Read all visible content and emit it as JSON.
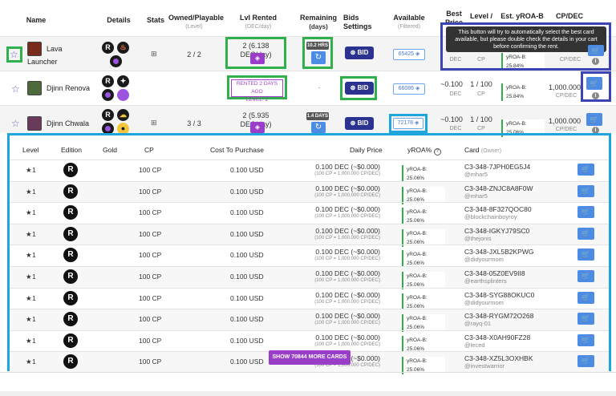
{
  "header": {
    "name": "Name",
    "details": "Details",
    "stats": "Stats",
    "owned": "Owned/Playable",
    "owned_sub": "(Level)",
    "lvl_rented": "Lvl Rented",
    "lvl_rented_sub": "(DEC/day)",
    "remaining": "Remaining",
    "remaining_sub": "(days)",
    "bids": "Bids",
    "bids2": "Settings",
    "available": "Available",
    "available_sub": "(Filtered)",
    "best_price": "Best",
    "best_price2": "Price",
    "level_cp": "Level /",
    "est_yroa": "Est. yROA-B",
    "cp_dec": "CP/DEC"
  },
  "tooltip": {
    "line1": "This button will try to automatically select the best card",
    "line2": "available, but please double check the details in your cart",
    "line3": "before confirming the rent."
  },
  "cards": [
    {
      "name": "Lava",
      "name2": "Launcher",
      "owned": "2 / 2",
      "rented": "2 (6.138 DEC/day)",
      "remaining_badge": "10.2 HRS",
      "bid": "BID",
      "available": "65425",
      "best_price_unit": "DEC",
      "level_unit": "CP",
      "yroa": "yROA-B: 25.84%",
      "cpdec_unit": "CP/DEC",
      "thumb_color": "#7a2a1a"
    },
    {
      "name": "Djinn Renova",
      "owned": "",
      "rented_line1": "RENTED 2 DAYS AGO",
      "rented_line2": "LEVEL: 2",
      "remaining": "-",
      "bid": "BID",
      "available": "66086",
      "best_price": "~0.100",
      "best_price_unit": "DEC",
      "level": "1 / 100",
      "level_unit": "CP",
      "yroa": "yROA-B: 25.84%",
      "cpdec": "1,000.000",
      "cpdec_unit": "CP/DEC",
      "thumb_color": "#4c6a3a"
    },
    {
      "name": "Djinn Chwala",
      "owned": "3 / 3",
      "rented": "2 (5.935 DEC/day)",
      "remaining_badge": "1.4 DAYS",
      "bid": "BID",
      "available": "72178",
      "best_price": "~0.100",
      "best_price_unit": "DEC",
      "level": "1 / 100",
      "level_unit": "CP",
      "yroa": "yROA-B: 25.06%",
      "cpdec": "1,000.000",
      "cpdec_unit": "CP/DEC",
      "thumb_color": "#6a3a5a"
    }
  ],
  "sub_table": {
    "headers": {
      "level": "Level",
      "edition": "Edition",
      "gold": "Gold",
      "cp": "CP",
      "cost": "Cost To Purchase",
      "daily": "Daily Price",
      "yroa": "yROA%",
      "card": "Card",
      "card_sub": "(Owner)"
    },
    "rows": [
      {
        "level": "1",
        "cp": "100 CP",
        "cost": "0.100 USD",
        "price": "0.100 DEC (~$0.000)",
        "price_sub": "(100 CP = 1,000.000 CP/DEC)",
        "yroa": "yROA-B: 25.06%",
        "card": "C3-348-7JPH0EG5J4",
        "owner": "@mhar5"
      },
      {
        "level": "1",
        "cp": "100 CP",
        "cost": "0.100 USD",
        "price": "0.100 DEC (~$0.000)",
        "price_sub": "(100 CP = 1,000.000 CP/DEC)",
        "yroa": "yROA-B: 25.06%",
        "card": "C3-348-ZNJC8A8F0W",
        "owner": "@mhar5"
      },
      {
        "level": "1",
        "cp": "100 CP",
        "cost": "0.100 USD",
        "price": "0.100 DEC (~$0.000)",
        "price_sub": "(100 CP = 1,000.000 CP/DEC)",
        "yroa": "yROA-B: 25.06%",
        "card": "C3-348-8F327QOC80",
        "owner": "@blockchainboyroy"
      },
      {
        "level": "1",
        "cp": "100 CP",
        "cost": "0.100 USD",
        "price": "0.100 DEC (~$0.000)",
        "price_sub": "(100 CP = 1,000.000 CP/DEC)",
        "yroa": "yROA-B: 25.06%",
        "card": "C3-348-IGKYJ79SC0",
        "owner": "@thejonis"
      },
      {
        "level": "1",
        "cp": "100 CP",
        "cost": "0.100 USD",
        "price": "0.100 DEC (~$0.000)",
        "price_sub": "(100 CP = 1,000.000 CP/DEC)",
        "yroa": "yROA-B: 25.06%",
        "card": "C3-348-JXL5B2KPWG",
        "owner": "@didyourmom"
      },
      {
        "level": "1",
        "cp": "100 CP",
        "cost": "0.100 USD",
        "price": "0.100 DEC (~$0.000)",
        "price_sub": "(100 CP = 1,000.000 CP/DEC)",
        "yroa": "yROA-B: 25.06%",
        "card": "C3-348-05Z0EV9II8",
        "owner": "@earthsplinters"
      },
      {
        "level": "1",
        "cp": "100 CP",
        "cost": "0.100 USD",
        "price": "0.100 DEC (~$0.000)",
        "price_sub": "(100 CP = 1,000.000 CP/DEC)",
        "yroa": "yROA-B: 25.06%",
        "card": "C3-348-SYG88OKUC0",
        "owner": "@didyourmom"
      },
      {
        "level": "1",
        "cp": "100 CP",
        "cost": "0.100 USD",
        "price": "0.100 DEC (~$0.000)",
        "price_sub": "(100 CP = 1,000.000 CP/DEC)",
        "yroa": "yROA-B: 25.06%",
        "card": "C3-348-RYGM72O268",
        "owner": "@rayq-01"
      },
      {
        "level": "1",
        "cp": "100 CP",
        "cost": "0.100 USD",
        "price": "0.100 DEC (~$0.000)",
        "price_sub": "(100 CP = 1,000.000 CP/DEC)",
        "yroa": "yROA-B: 25.06%",
        "card": "C3-348-X0AH90FZ28",
        "owner": "@leced"
      },
      {
        "level": "1",
        "cp": "100 CP",
        "cost": "0.100 USD",
        "price": "0.100 DEC (~$0.000)",
        "price_sub": "(100 CP = 1,000.000 CP/DEC)",
        "yroa": "yROA-B: 25.06%",
        "card": "C3-348-XZ5L3OXHBK",
        "owner": "@investwarrior"
      }
    ],
    "more_button": "SHOW 70844 MORE CARDS"
  },
  "colors": {
    "green": "#2fb04d",
    "navy": "#3c43b3",
    "cyan": "#1ea6dc",
    "purple": "#9a3ec9",
    "blue": "#4c8ce4"
  },
  "icons": {
    "star": "star-icon",
    "cart": "cart-icon",
    "refresh": "refresh-icon",
    "layers": "layers-icon",
    "bid": "bid-icon",
    "info": "info-icon"
  }
}
